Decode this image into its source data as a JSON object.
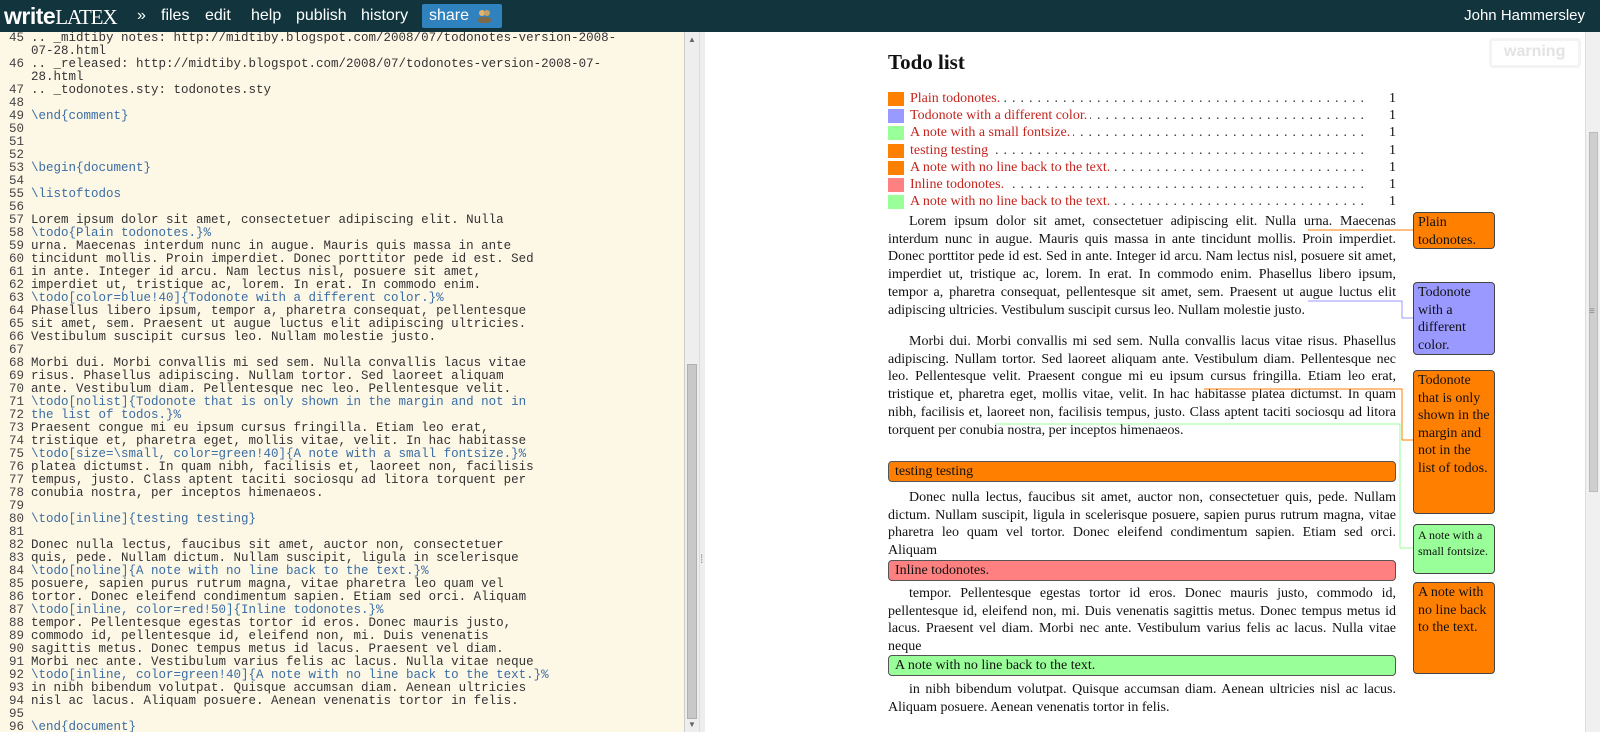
{
  "app": {
    "brand_main": "write",
    "brand_latex": "LATEX",
    "menu": {
      "expand": "»",
      "files": "files",
      "edit": "edit",
      "help": "help",
      "publish": "publish",
      "history": "history",
      "share": "share"
    },
    "user": "John Hammersley"
  },
  "editor": {
    "lines": [
      {
        "n": "45",
        "t": ".. _midtiby notes: http://midtiby.blogspot.com/2008/07/todonotes-version-2008-"
      },
      {
        "n": "",
        "t": "07-28.html"
      },
      {
        "n": "46",
        "t": ".. _released: http://midtiby.blogspot.com/2008/07/todonotes-version-2008-07-"
      },
      {
        "n": "",
        "t": "28.html"
      },
      {
        "n": "47",
        "t": ".. _todonotes.sty: todonotes.sty"
      },
      {
        "n": "48",
        "t": ""
      },
      {
        "n": "49",
        "t": "\\end{comment}",
        "kw": true
      },
      {
        "n": "50",
        "t": ""
      },
      {
        "n": "51",
        "t": ""
      },
      {
        "n": "52",
        "t": ""
      },
      {
        "n": "53",
        "t": "\\begin{document}",
        "kw": true
      },
      {
        "n": "54",
        "t": ""
      },
      {
        "n": "55",
        "t": "\\listoftodos",
        "kw": true
      },
      {
        "n": "56",
        "t": ""
      },
      {
        "n": "57",
        "t": "Lorem ipsum dolor sit amet, consectetuer adipiscing elit. Nulla"
      },
      {
        "n": "58",
        "t": "\\todo{Plain todonotes.}%",
        "kw": true
      },
      {
        "n": "59",
        "t": "urna. Maecenas interdum nunc in augue. Mauris quis massa in ante"
      },
      {
        "n": "60",
        "t": "tincidunt mollis. Proin imperdiet. Donec porttitor pede id est. Sed"
      },
      {
        "n": "61",
        "t": "in ante. Integer id arcu. Nam lectus nisl, posuere sit amet,"
      },
      {
        "n": "62",
        "t": "imperdiet ut, tristique ac, lorem. In erat. In commodo enim."
      },
      {
        "n": "63",
        "t": "\\todo[color=blue!40]{Todonote with a different color.}%",
        "kw": true
      },
      {
        "n": "64",
        "t": "Phasellus libero ipsum, tempor a, pharetra consequat, pellentesque"
      },
      {
        "n": "65",
        "t": "sit amet, sem. Praesent ut augue luctus elit adipiscing ultricies."
      },
      {
        "n": "66",
        "t": "Vestibulum suscipit cursus leo. Nullam molestie justo."
      },
      {
        "n": "67",
        "t": ""
      },
      {
        "n": "68",
        "t": "Morbi dui. Morbi convallis mi sed sem. Nulla convallis lacus vitae"
      },
      {
        "n": "69",
        "t": "risus. Phasellus adipiscing. Nullam tortor. Sed laoreet aliquam"
      },
      {
        "n": "70",
        "t": "ante. Vestibulum diam. Pellentesque nec leo. Pellentesque velit."
      },
      {
        "n": "71",
        "t": "\\todo[nolist]{Todonote that is only shown in the margin and not in",
        "kw": true
      },
      {
        "n": "72",
        "t": "the list of todos.}%",
        "kw": true
      },
      {
        "n": "73",
        "t": "Praesent congue mi eu ipsum cursus fringilla. Etiam leo erat,"
      },
      {
        "n": "74",
        "t": "tristique et, pharetra eget, mollis vitae, velit. In hac habitasse"
      },
      {
        "n": "75",
        "t": "\\todo[size=\\small, color=green!40]{A note with a small fontsize.}%",
        "kw": true
      },
      {
        "n": "76",
        "t": "platea dictumst. In quam nibh, facilisis et, laoreet non, facilisis"
      },
      {
        "n": "77",
        "t": "tempus, justo. Class aptent taciti sociosqu ad litora torquent per"
      },
      {
        "n": "78",
        "t": "conubia nostra, per inceptos himenaeos."
      },
      {
        "n": "79",
        "t": ""
      },
      {
        "n": "80",
        "t": "\\todo[inline]{testing testing}",
        "kw": true
      },
      {
        "n": "81",
        "t": ""
      },
      {
        "n": "82",
        "t": "Donec nulla lectus, faucibus sit amet, auctor non, consectetuer"
      },
      {
        "n": "83",
        "t": "quis, pede. Nullam dictum. Nullam suscipit, ligula in scelerisque"
      },
      {
        "n": "84",
        "t": "\\todo[noline]{A note with no line back to the text.}%",
        "kw": true
      },
      {
        "n": "85",
        "t": "posuere, sapien purus rutrum magna, vitae pharetra leo quam vel"
      },
      {
        "n": "86",
        "t": "tortor. Donec eleifend condimentum sapien. Etiam sed orci. Aliquam"
      },
      {
        "n": "87",
        "t": "\\todo[inline, color=red!50]{Inline todonotes.}%",
        "kw": true
      },
      {
        "n": "88",
        "t": "tempor. Pellentesque egestas tortor id eros. Donec mauris justo,"
      },
      {
        "n": "89",
        "t": "commodo id, pellentesque id, eleifend non, mi. Duis venenatis"
      },
      {
        "n": "90",
        "t": "sagittis metus. Donec tempus metus id lacus. Praesent vel diam."
      },
      {
        "n": "91",
        "t": "Morbi nec ante. Vestibulum varius felis ac lacus. Nulla vitae neque"
      },
      {
        "n": "92",
        "t": "\\todo[inline, color=green!40]{A note with no line back to the text.}%",
        "kw": true
      },
      {
        "n": "93",
        "t": "in nibh bibendum volutpat. Quisque accumsan diam. Aenean ultricies"
      },
      {
        "n": "94",
        "t": "nisl ac lacus. Aliquam posuere. Aenean venenatis tortor in felis."
      },
      {
        "n": "95",
        "t": ""
      },
      {
        "n": "96",
        "t": "\\end{document}",
        "kw": true
      }
    ]
  },
  "preview": {
    "warning": "warning",
    "title": "Todo list",
    "toc": [
      {
        "label": "Plain todonotes.",
        "page": "1",
        "color": "#ff7f00"
      },
      {
        "label": "Todonote with a different color.",
        "page": "1",
        "color": "#9999ff"
      },
      {
        "label": "A note with a small fontsize.",
        "page": "1",
        "color": "#99ff99"
      },
      {
        "label": "testing testing",
        "page": "1",
        "color": "#ff7f00"
      },
      {
        "label": "A note with no line back to the text.",
        "page": "1",
        "color": "#ff7f00"
      },
      {
        "label": "Inline todonotes.",
        "page": "1",
        "color": "#ff8080"
      },
      {
        "label": "A note with no line back to the text.",
        "page": "1",
        "color": "#99ff99"
      }
    ],
    "para1": "Lorem ipsum dolor sit amet, consectetuer adipiscing elit. Nulla urna. Maecenas interdum nunc in augue. Mauris quis massa in ante tincidunt mollis. Proin imperdiet. Donec porttitor pede id est. Sed in ante. Integer id arcu. Nam lectus nisl, posuere sit amet, imperdiet ut, tristique ac, lorem. In erat. In commodo enim. Phasellus libero ipsum, tempor a, pharetra consequat, pellentesque sit amet, sem. Praesent ut augue luctus elit adipiscing ultricies. Vestibulum suscipit cursus leo. Nullam molestie justo.",
    "para2": "Morbi dui. Morbi convallis mi sed sem. Nulla convallis lacus vitae risus. Phasellus adipiscing. Nullam tortor. Sed laoreet aliquam ante. Vestibulum diam. Pellentesque nec leo. Pellentesque velit. Praesent congue mi eu ipsum cursus fringilla. Etiam leo erat, tristique et, pharetra eget, mollis vitae, velit. In hac habitasse platea dictumst. In quam nibh, facilisis et, laoreet non, facilisis tempus, justo. Class aptent taciti sociosqu ad litora torquent per conubia nostra, per inceptos himenaeos.",
    "inline1": "testing testing",
    "para3": "Donec nulla lectus, faucibus sit amet, auctor non, consectetuer quis, pede. Nullam dictum. Nullam suscipit, ligula in scelerisque posuere, sapien purus rutrum magna, vitae pharetra leo quam vel tortor. Donec eleifend condimentum sapien. Etiam sed orci. Aliquam",
    "inline2": "Inline todonotes.",
    "para4": "tempor. Pellentesque egestas tortor id eros. Donec mauris justo, commodo id, pellentesque id, eleifend non, mi. Duis venenatis sagittis metus. Donec tempus metus id lacus. Praesent vel diam. Morbi nec ante. Vestibulum varius felis ac lacus. Nulla vitae neque",
    "inline3": "A note with no line back to the text.",
    "para5": "in nibh bibendum volutpat. Quisque accumsan diam. Aenean ultricies nisl ac lacus. Aliquam posuere. Aenean venenatis tortor in felis.",
    "margin": {
      "plain": "Plain todonotes.",
      "color": "Todonote with a different color.",
      "nolist": "Todonote that is only shown in the margin and not in the list of todos.",
      "small": "A note with a small fontsize.",
      "noline": "A note with no line back to the text."
    },
    "colors": {
      "orange": "#ff7f00",
      "blue": "#9999ff",
      "green": "#99ff99",
      "red": "#ff8080"
    }
  }
}
